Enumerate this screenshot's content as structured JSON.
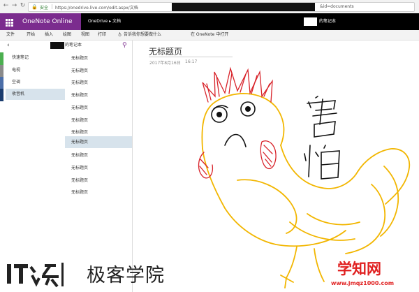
{
  "browser": {
    "secure_label": "安全",
    "url_prefix": "https://onedrive.live.com/edit.aspx/文档",
    "url_suffix": "&id=documents"
  },
  "app": {
    "name": "OneNote Online",
    "breadcrumb": "OneDrive ▸ 文档",
    "notebook_name": "的笔记本"
  },
  "ribbon": {
    "tabs": [
      "文件",
      "开始",
      "插入",
      "绘图",
      "视图",
      "打印"
    ],
    "tell_me": "告诉我你想要做什么",
    "open_in_onenote": "在 OneNote 中打开"
  },
  "pages_pane": {
    "notebook_title": "的笔记本"
  },
  "sections": [
    {
      "label": "快速笔记",
      "color": "#4caf50",
      "active": false
    },
    {
      "label": "电视",
      "color": "#8a8a8a",
      "active": false
    },
    {
      "label": "空调",
      "color": "#4b6ea8",
      "active": false
    },
    {
      "label": "收音机",
      "color": "#1a3c6e",
      "active": true
    }
  ],
  "pages": [
    {
      "label": "无标题页",
      "active": false
    },
    {
      "label": "无标题页",
      "active": false
    },
    {
      "label": "无标题页",
      "active": false
    },
    {
      "label": "无标题页",
      "active": false
    },
    {
      "label": "无标题页",
      "active": false
    },
    {
      "label": "无标题页",
      "active": false
    },
    {
      "label": "无标题页",
      "active": false
    },
    {
      "label": "无标题页",
      "active": true
    },
    {
      "label": "无标题页",
      "active": false
    },
    {
      "label": "无标题页",
      "active": false
    },
    {
      "label": "无标题页",
      "active": false
    },
    {
      "label": "无标题页",
      "active": false
    }
  ],
  "page": {
    "title": "无标题页",
    "date": "2017年8月16日",
    "time": "16:17"
  },
  "drawing": {
    "text_chars": [
      "害",
      "怕"
    ]
  },
  "watermarks": {
    "left_logo": "IT之家",
    "left_text": "极客学院",
    "right_text": "学知网",
    "right_url": "www.jmqz1000.com"
  },
  "colors": {
    "brand_purple": "#7b2c8e",
    "selection": "#d7e3ec",
    "ink_yellow": "#f2b600",
    "ink_red": "#d8232a",
    "ink_black": "#111111"
  }
}
